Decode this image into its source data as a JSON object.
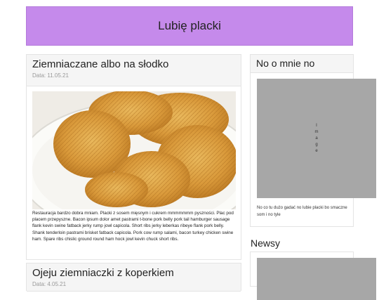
{
  "header": {
    "title": "Lubię placki"
  },
  "posts": [
    {
      "title": "Ziemniaczane albo na słodko",
      "date": "Data: 11.05.21",
      "text": "Restauracja bardzo dobra mniam. Placki z sosem mięsnym i cukrem mmmmmmm pyszności. Plac pod placem przepyszne. Bacon ipsum dolor amet pastrami t-bone pork belly pork tail hamburger sausage flank kevin swine fatback jerky rump jowl capicola. Short ribs jerky leberkas ribeye flank pork belly. Shank tenderloin pastrami brisket fatback capicola. Pork cow rump salami, bacon turkey chicken swine ham. Spare ribs chislic ground round ham hock jowl kevin chuck short ribs."
    },
    {
      "title": "Ojeju ziemniaczki z koperkiem",
      "date": "Data: 4.05.21"
    }
  ],
  "sidebar": {
    "about_title": "No o mnie no",
    "image_placeholder": "Image",
    "about_text": "No co tu dużo gadać no lubie placki bo smaczne som i no tyle",
    "news_title": "Newsy"
  },
  "colors": {
    "header_bg": "#c58aeb",
    "placeholder_bg": "#a7a7a7",
    "card_head_bg": "#f5f5f5"
  }
}
